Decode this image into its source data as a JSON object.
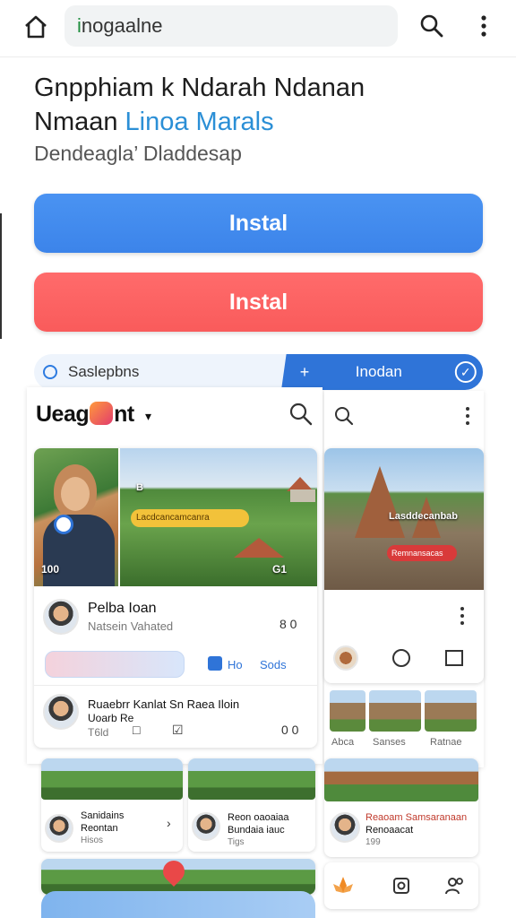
{
  "browser": {
    "url_accent": "i",
    "url_rest": "nogaalne"
  },
  "hero": {
    "title_line1": "Gnpphiam k Ndarah Ndanan",
    "title_line2_plain": "Nmaan ",
    "title_line2_link": "Linoa Marals",
    "subtitle": "Dendeagla’ Dladdesap",
    "install_primary": "Instal",
    "install_secondary": "Instal"
  },
  "segment": {
    "left_label": "Saslepbns",
    "right_label": "Inodan",
    "plus": "+",
    "check": "✓"
  },
  "app": {
    "brand_prefix": "Ueag",
    "brand_suffix": "nt",
    "caret": "▾"
  },
  "feed": {
    "post1": {
      "tag_small": "B",
      "banner": "Lacdcancamcanra",
      "corner_left": "100",
      "corner_right": "G1",
      "author": "Pelba Ioan",
      "author_meta": "Natsein Vahated",
      "count": "8 0",
      "chip1": "Ho",
      "chip2": "Sods"
    },
    "post2": {
      "title": "Ruaebrr Kanlat Sn Raea Iloin",
      "subtitle": "Uoarb Re",
      "stat1": "T6ld",
      "stat2": "□",
      "stat3": "☑",
      "count": "0 0"
    },
    "small_cards": [
      {
        "title": "Sanidains",
        "subtitle": "Reontan",
        "meta": "Hisos",
        "chev": "›"
      },
      {
        "title": "Reon oaoaiaa",
        "subtitle": "Bundaia iauc",
        "meta": "Tigs"
      }
    ]
  },
  "right": {
    "temple_caption": "Lasddecanbab",
    "temple_pill": "Remnansacas",
    "mini_labels": [
      "Abca",
      "Sanses",
      "Ratnae"
    ],
    "card_title": "Reaoam Samsaranaan",
    "card_subtitle": "Renoaacat",
    "card_meta": "199"
  }
}
